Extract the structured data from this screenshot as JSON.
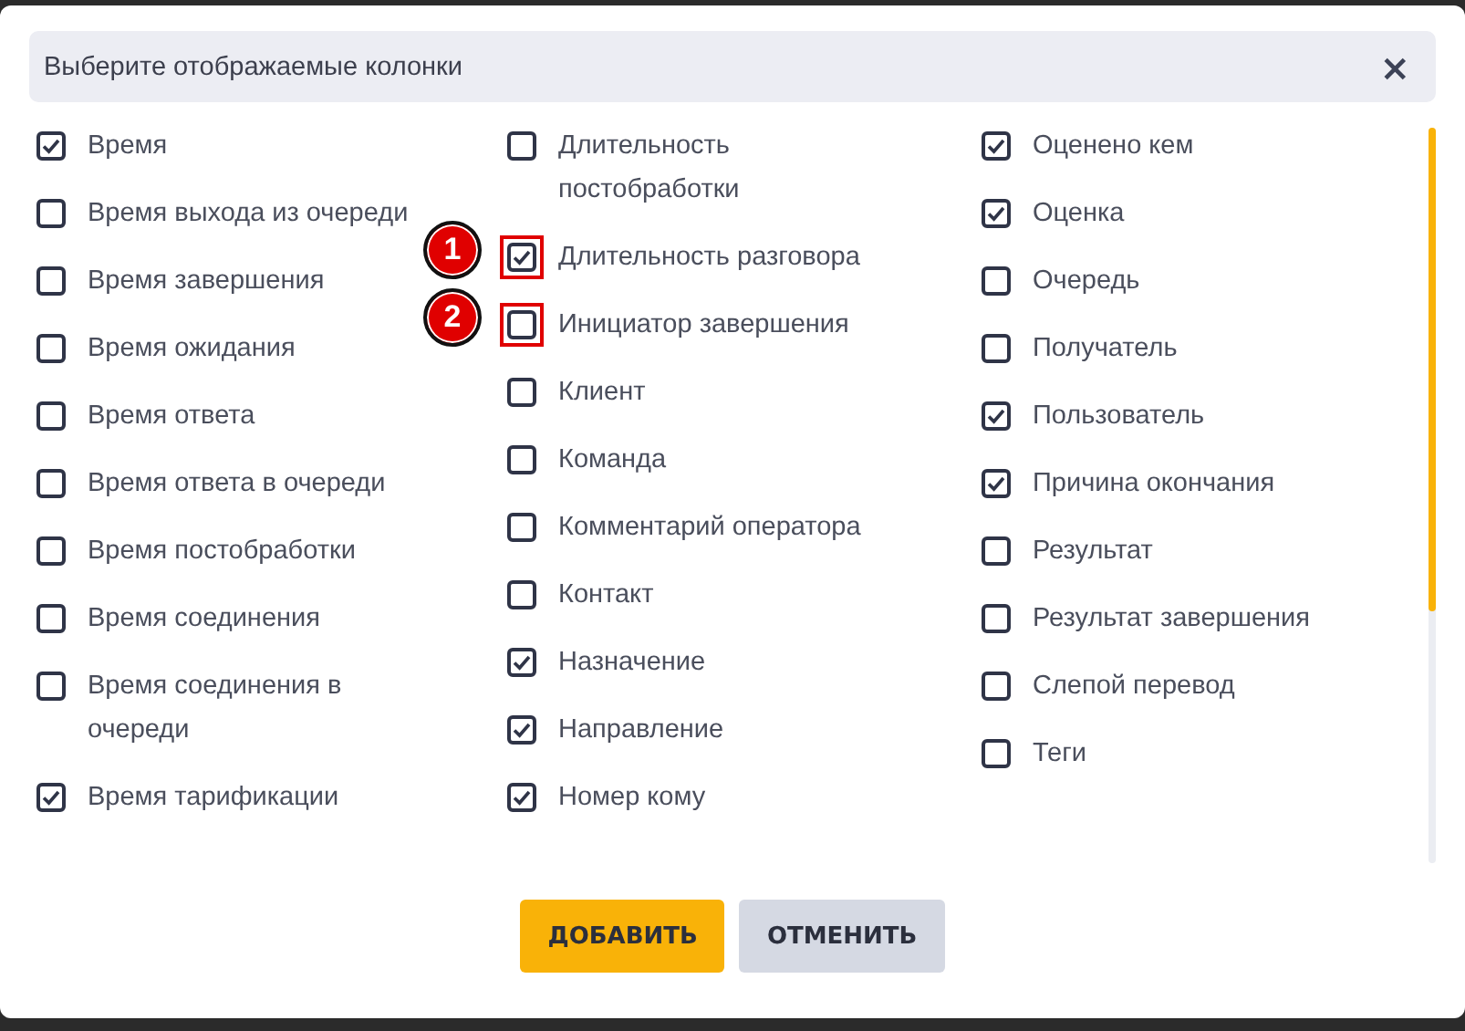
{
  "dialog": {
    "title": "Выберите отображаемые колонки",
    "close": "×"
  },
  "columns": [
    [
      {
        "label": "Время",
        "checked": true
      },
      {
        "label": "Время выхода из очереди",
        "checked": false
      },
      {
        "label": "Время завершения",
        "checked": false
      },
      {
        "label": "Время ожидания",
        "checked": false
      },
      {
        "label": "Время ответа",
        "checked": false
      },
      {
        "label": "Время ответа в очереди",
        "checked": false
      },
      {
        "label": "Время постобработки",
        "checked": false
      },
      {
        "label": "Время соединения",
        "checked": false
      },
      {
        "label": "Время соединения в очереди",
        "checked": false
      },
      {
        "label": "Время тарификации",
        "checked": true
      }
    ],
    [
      {
        "label": "Длительность постобработки",
        "checked": false
      },
      {
        "label": "Длительность разговора",
        "checked": true,
        "callout": "1"
      },
      {
        "label": "Инициатор завершения",
        "checked": false,
        "callout": "2"
      },
      {
        "label": "Клиент",
        "checked": false
      },
      {
        "label": "Команда",
        "checked": false
      },
      {
        "label": "Комментарий оператора",
        "checked": false
      },
      {
        "label": "Контакт",
        "checked": false
      },
      {
        "label": "Назначение",
        "checked": true
      },
      {
        "label": "Направление",
        "checked": true
      },
      {
        "label": "Номер кому",
        "checked": true
      }
    ],
    [
      {
        "label": "Оценено кем",
        "checked": true
      },
      {
        "label": "Оценка",
        "checked": true
      },
      {
        "label": "Очередь",
        "checked": false
      },
      {
        "label": "Получатель",
        "checked": false
      },
      {
        "label": "Пользователь",
        "checked": true
      },
      {
        "label": "Причина окончания",
        "checked": true
      },
      {
        "label": "Результат",
        "checked": false
      },
      {
        "label": "Результат завершения",
        "checked": false
      },
      {
        "label": "Слепой перевод",
        "checked": false
      },
      {
        "label": "Теги",
        "checked": false
      }
    ]
  ],
  "buttons": [
    {
      "label": "ДОБАВИТЬ",
      "kind": "primary"
    },
    {
      "label": "ОТМЕНИТЬ",
      "kind": "secondary"
    }
  ]
}
